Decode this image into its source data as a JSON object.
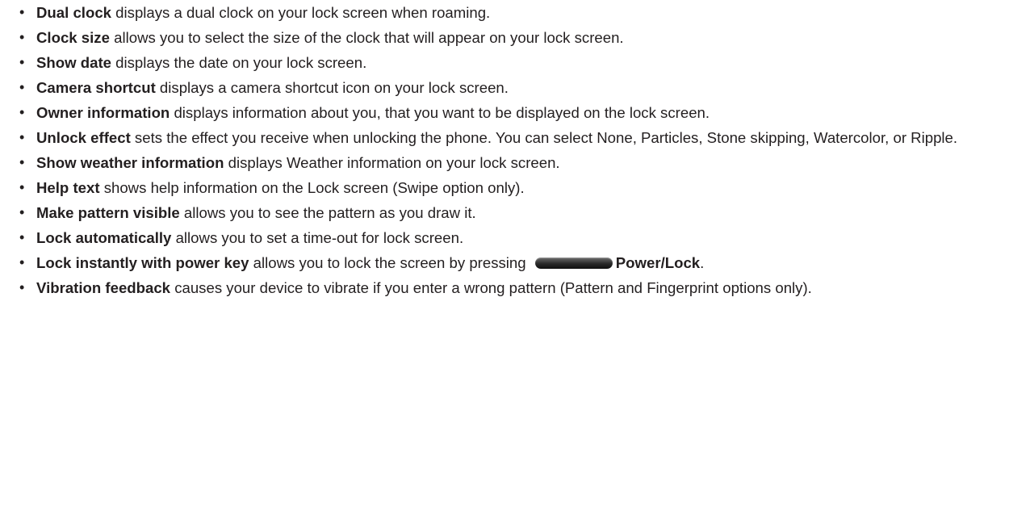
{
  "bullet_symbol": "•",
  "items": [
    {
      "term": "Dual clock",
      "description": " displays a dual clock on your lock screen when roaming."
    },
    {
      "term": "Clock size",
      "description": " allows you to select the size of the clock that will appear on your lock screen."
    },
    {
      "term": "Show date",
      "description": " displays the date on your lock screen."
    },
    {
      "term": "Camera shortcut",
      "description": " displays a camera shortcut icon on your lock screen."
    },
    {
      "term": "Owner information",
      "description": " displays information about you, that you want to be displayed on the lock screen."
    },
    {
      "term": "Unlock effect",
      "description": " sets the effect you receive when unlocking the phone. You can select None, Particles, Stone skipping, Watercolor, or Ripple."
    },
    {
      "term": "Show weather information",
      "description": " displays Weather information on your lock screen."
    },
    {
      "term": "Help text",
      "description": " shows help information on the Lock screen (Swipe option only)."
    },
    {
      "term": "Make pattern visible",
      "description": " allows you to see the pattern as you draw it."
    },
    {
      "term": "Lock automatically",
      "description": " allows you to set a time-out for lock screen."
    },
    {
      "term": "Lock instantly with power key",
      "description": " allows you to lock the screen by pressing ",
      "key_icon": "power-key-icon",
      "key_label": "Power/Lock",
      "suffix": "."
    },
    {
      "term": "Vibration feedback",
      "description": " causes your device to vibrate if you enter a wrong pattern (Pattern and Fingerprint options only)."
    }
  ]
}
